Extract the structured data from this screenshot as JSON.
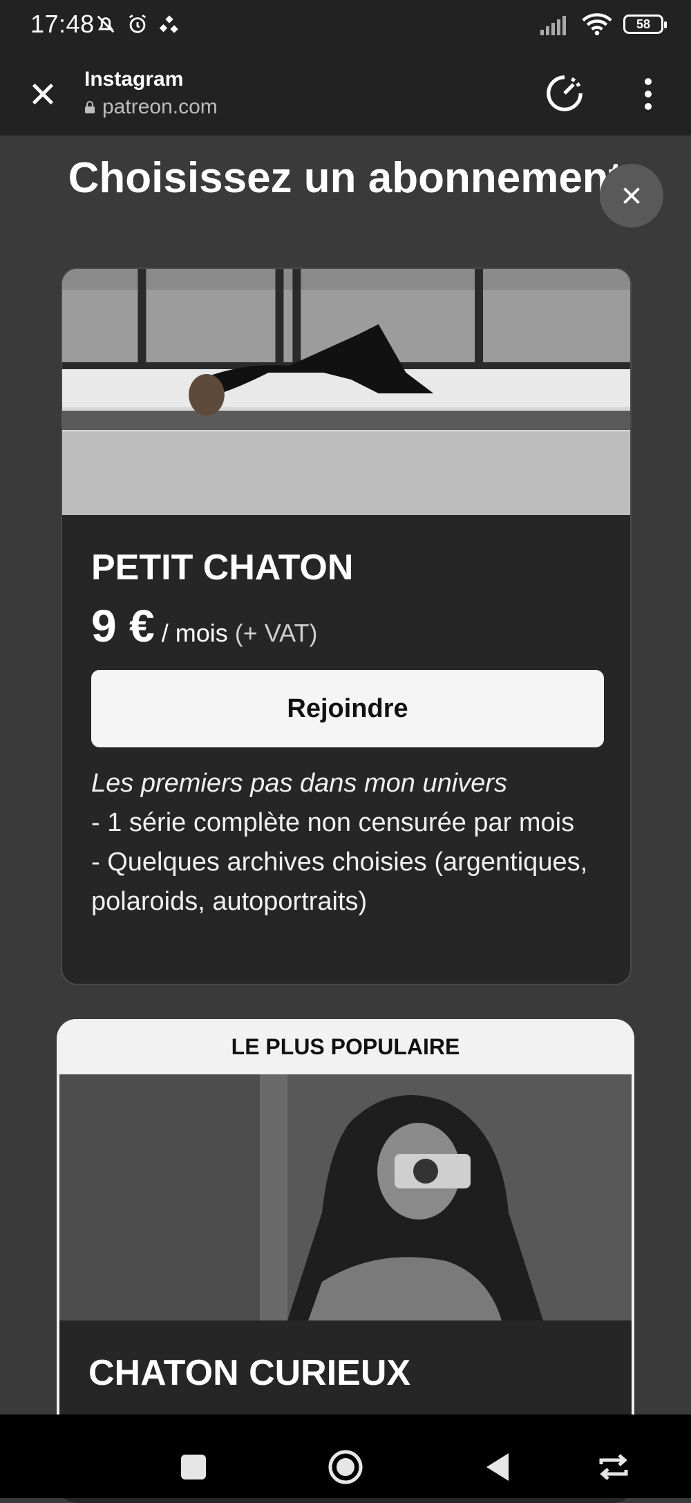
{
  "status_bar": {
    "time": "17:48",
    "battery": "58",
    "icons_left": [
      "bell-off-icon",
      "alarm-icon",
      "sync-app-icon"
    ],
    "icons_right": [
      "signal-icon",
      "wifi-icon",
      "battery-icon"
    ]
  },
  "browser": {
    "title": "Instagram",
    "url": "patreon.com"
  },
  "page": {
    "title": "Choisissez un abonnement"
  },
  "tiers": [
    {
      "name": "PETIT CHATON",
      "price": "9 €",
      "per": "/ mois",
      "vat": "(+ VAT)",
      "button": "Rejoindre",
      "description_title": "Les premiers pas dans mon univers",
      "description_lines": [
        "- 1 série complète non censurée par mois",
        "- Quelques archives choisies (argentiques, polaroids, autoportraits)"
      ]
    },
    {
      "badge": "LE PLUS POPULAIRE",
      "name": "CHATON CURIEUX"
    }
  ],
  "colors": {
    "background": "#3a3a3a",
    "card": "#262626",
    "button": "#f5f5f5",
    "bars": "#222222"
  }
}
